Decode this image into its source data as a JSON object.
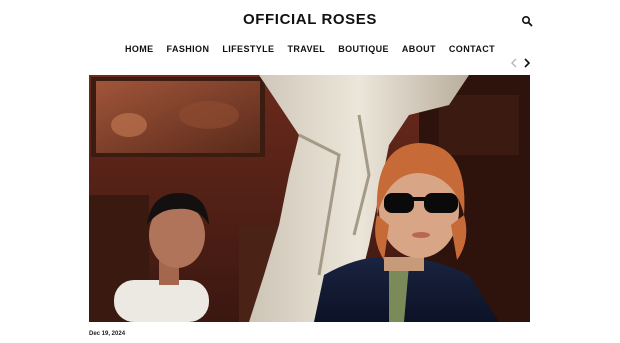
{
  "header": {
    "site_title": "OFFICIAL ROSES"
  },
  "nav": {
    "items": [
      {
        "label": "HOME"
      },
      {
        "label": "FASHION"
      },
      {
        "label": "LIFESTYLE"
      },
      {
        "label": "TRAVEL"
      },
      {
        "label": "BOUTIQUE"
      },
      {
        "label": "ABOUT"
      },
      {
        "label": "CONTACT"
      }
    ]
  },
  "slider": {
    "prev_icon": "chevron-left-icon",
    "next_icon": "chevron-right-icon"
  },
  "post": {
    "date": "Dec 19, 2024"
  },
  "colors": {
    "text": "#111111",
    "arrow_disabled": "#bbbbbb"
  }
}
